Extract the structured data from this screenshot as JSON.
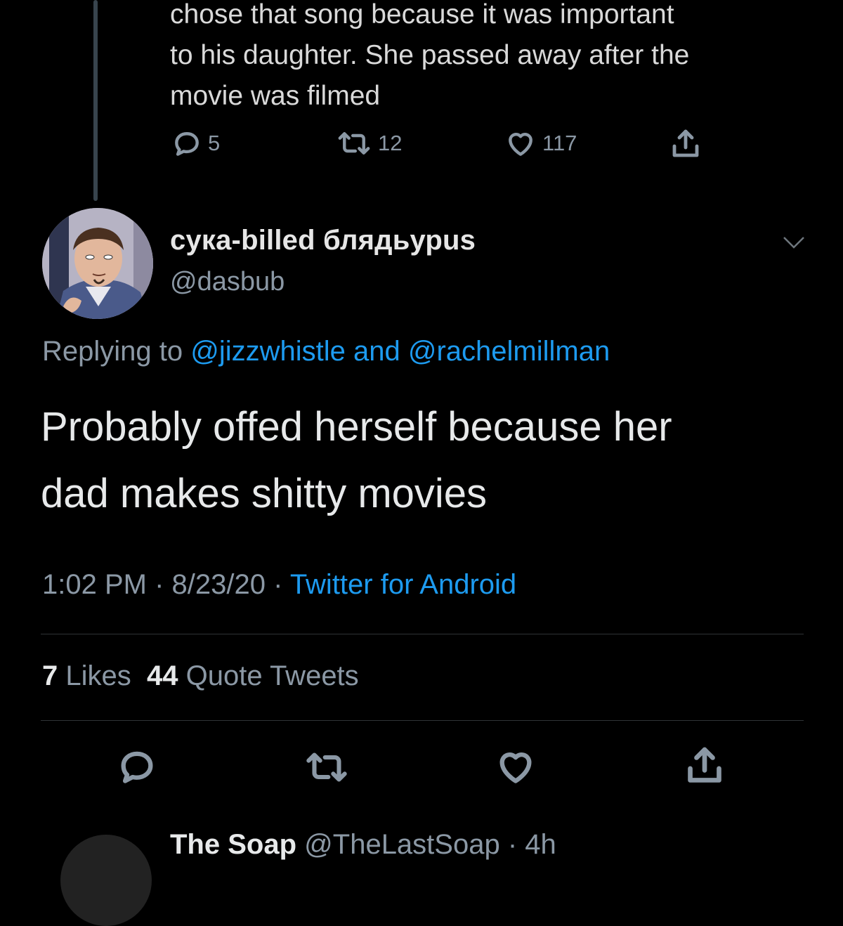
{
  "previous_tweet": {
    "text_lines": [
      "chose that song because it was important",
      "to his daughter. She passed away after the",
      "movie was filmed"
    ],
    "reply_count": "5",
    "retweet_count": "12",
    "like_count": "117"
  },
  "tweet": {
    "display_name": "сука-billed блядьурus",
    "handle": "@dasbub",
    "replying_prefix": "Replying to ",
    "replying_to_1": "@jizzwhistle",
    "replying_and": " and ",
    "replying_to_2": "@rachelmillman",
    "text_line_1": "Probably offed herself because her",
    "text_line_2": "dad makes shitty movies",
    "time": "1:02 PM",
    "separator": " · ",
    "date": "8/23/20",
    "source": "Twitter for Android",
    "likes_count": "7",
    "likes_label": " Likes",
    "quotes_count": "44",
    "quotes_label": " Quote Tweets"
  },
  "next_tweet": {
    "display_name": "The Soap",
    "handle_time": "@TheLastSoap · 4h"
  },
  "icons": {
    "reply": "reply-icon",
    "retweet": "retweet-icon",
    "like": "heart-icon",
    "share": "share-icon",
    "menu": "chevron-down-icon"
  },
  "colors": {
    "background": "#000000",
    "link": "#1d9bf0",
    "muted": "#8b98a5",
    "text": "#e7e9ea"
  }
}
